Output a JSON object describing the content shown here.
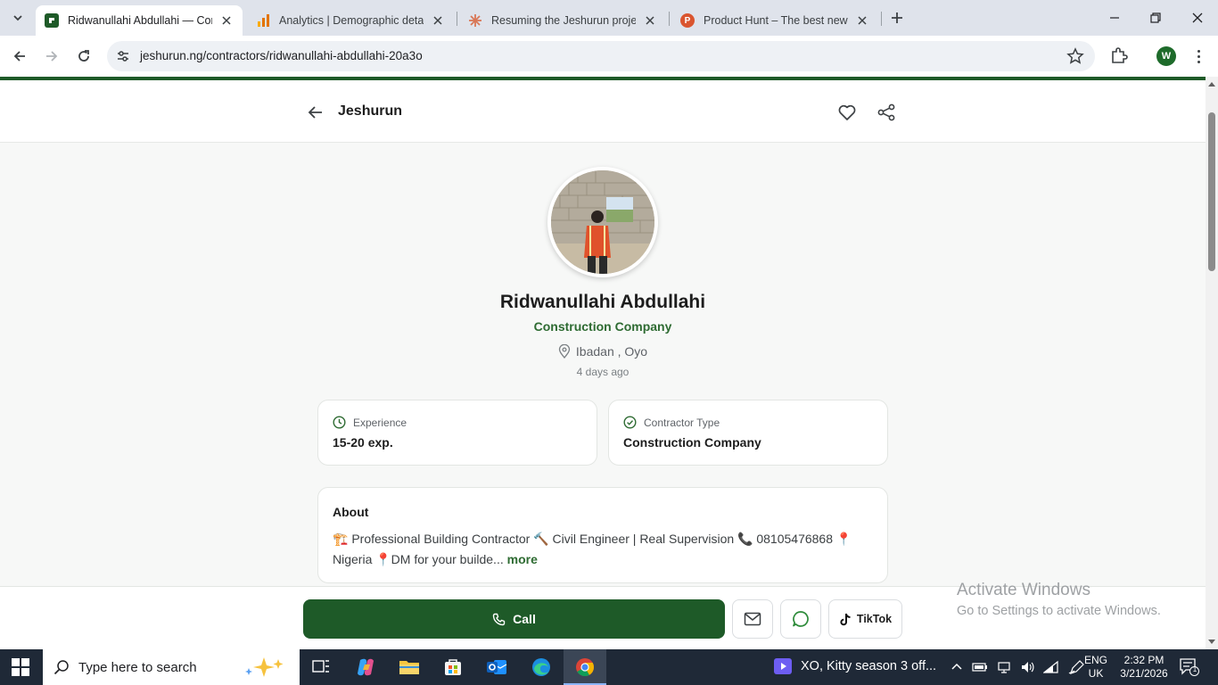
{
  "browser": {
    "tabs": [
      {
        "title": "Ridwanullahi Abdullahi — Cons",
        "active": true
      },
      {
        "title": "Analytics | Demographic details",
        "active": false
      },
      {
        "title": "Resuming the Jeshurun project",
        "active": false
      },
      {
        "title": "Product Hunt – The best new p",
        "active": false
      }
    ],
    "url": "jeshurun.ng/contractors/ridwanullahi-abdullahi-20a3o",
    "profile_initial": "W"
  },
  "page": {
    "brand": "Jeshurun",
    "name": "Ridwanullahi Abdullahi",
    "company": "Construction Company",
    "location": "Ibadan , Oyo",
    "posted": "4 days ago",
    "cards": [
      {
        "label": "Experience",
        "value": "15-20 exp.",
        "icon": "clock-icon"
      },
      {
        "label": "Contractor Type",
        "value": "Construction Company",
        "icon": "check-circle-icon"
      }
    ],
    "about": {
      "title": "About",
      "text": "🏗️ Professional Building Contractor 🔨 Civil Engineer | Real Supervision 📞 08105476868 📍Nigeria 📍DM for your builde...",
      "more": "more"
    },
    "actions": {
      "call": "Call",
      "tiktok": "TikTok"
    },
    "watermark": {
      "line1": "Activate Windows",
      "line2": "Go to Settings to activate Windows."
    }
  },
  "taskbar": {
    "search_placeholder": "Type here to search",
    "media_title": "XO, Kitty season 3 off...",
    "lang": "ENG",
    "region": "UK",
    "time": "2:32 PM",
    "date": "3/21/2026",
    "notifications": "1"
  },
  "colors": {
    "brand_green": "#1e5a28",
    "accent_green": "#2e6b32",
    "chrome_bg": "#dfe3eb"
  }
}
